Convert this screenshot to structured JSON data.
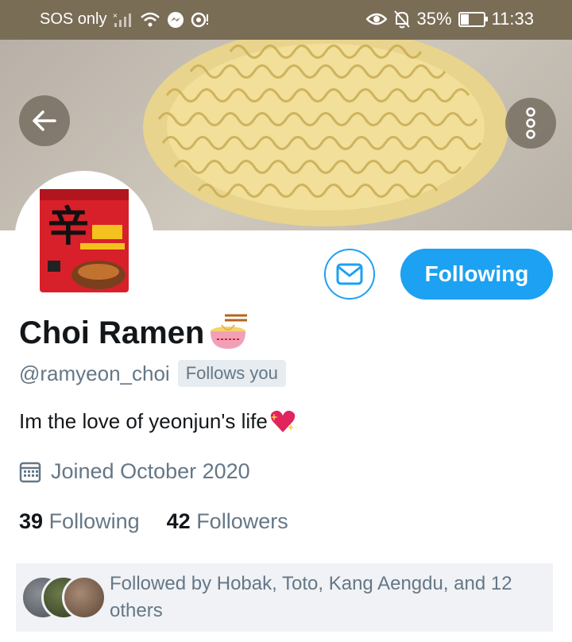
{
  "status_bar": {
    "carrier": "SOS only",
    "battery": "35%",
    "battery_level": 0.35,
    "time": "11:33"
  },
  "profile": {
    "name": "Choi Ramen",
    "handle": "@ramyeon_choi",
    "follows_you_badge": "Follows you",
    "bio": "Im the love of yeonjun's life",
    "joined": "Joined October 2020",
    "following_count": "39",
    "following_label": "Following",
    "followers_count": "42",
    "followers_label": "Followers"
  },
  "actions": {
    "follow_button_label": "Following"
  },
  "followed_by": {
    "text": "Followed by Hobak, Toto, Kang Aengdu, and 12 others"
  },
  "icons": [
    "back-arrow-icon",
    "more-options-icon",
    "message-icon",
    "calendar-icon",
    "ramen-emoji-icon",
    "sparkling-heart-icon"
  ],
  "colors": {
    "accent": "#1da1f2",
    "secondary_text": "#657786",
    "primary_text": "#14171a",
    "status_bar": "#7a6d56"
  }
}
